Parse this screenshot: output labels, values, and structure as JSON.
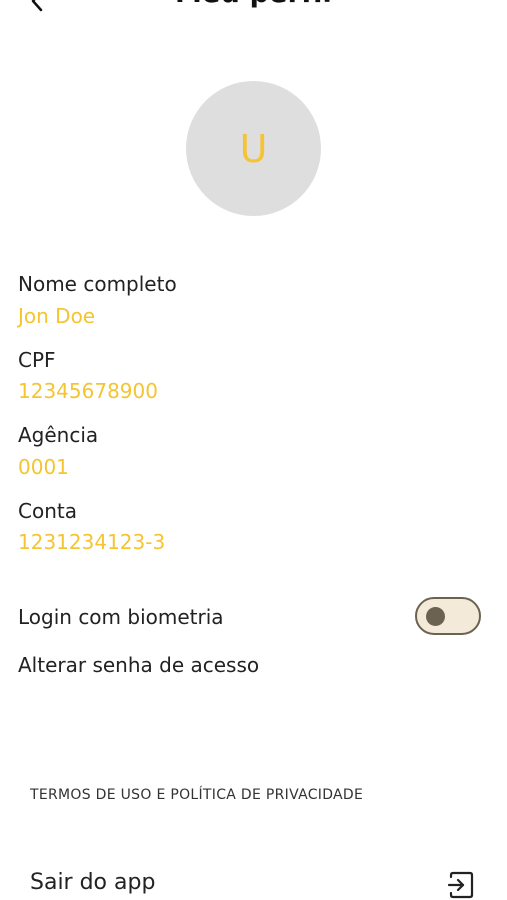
{
  "header": {
    "title": "Meu perfil",
    "back_icon": "chevron-left-icon"
  },
  "avatar": {
    "initial": "U",
    "background": "#dedede",
    "initial_color": "#f5c431"
  },
  "profile": {
    "fields": [
      {
        "label": "Nome completo",
        "value": "Jon Doe"
      },
      {
        "label": "CPF",
        "value": "12345678900"
      },
      {
        "label": "Agência",
        "value": "0001"
      },
      {
        "label": "Conta",
        "value": "1231234123-3"
      }
    ]
  },
  "settings": {
    "biometric_label": "Login com biometria",
    "biometric_enabled": false,
    "change_password_label": "Alterar senha de acesso"
  },
  "footer": {
    "terms_label": "TERMOS DE USO E POLÍTICA DE PRIVACIDADE",
    "logout_label": "Sair do app",
    "logout_icon": "logout-icon"
  },
  "colors": {
    "accent": "#f5c431",
    "text": "#222222",
    "toggle_track": "#f3ead9",
    "toggle_border": "#6b6350"
  }
}
